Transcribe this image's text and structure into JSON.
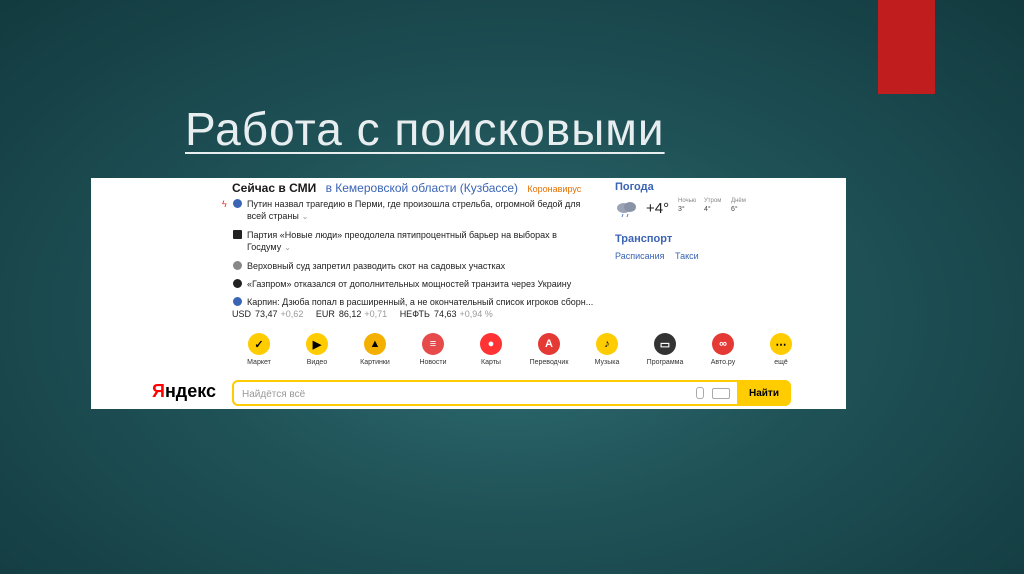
{
  "slide": {
    "title": "Работа с поисковыми"
  },
  "news": {
    "heading": "Сейчас в СМИ",
    "region": "в Кемеровской области (Кузбассе)",
    "tag": "Коронавирус",
    "items": [
      {
        "text": "Путин назвал трагедию в Перми, где произошла стрельба, огромной бедой для всей страны",
        "chevron": "⌄"
      },
      {
        "text": "Партия «Новые люди» преодолела пятипроцентный барьер на выборах в Госдуму",
        "chevron": "⌄"
      },
      {
        "text": "Верховный суд запретил разводить скот на садовых участках"
      },
      {
        "text": "«Газпром» отказался от дополнительных мощностей транзита через Украину"
      },
      {
        "text": "Карпин: Дзюба попал в расширенный, а не окончательный список игроков сборн..."
      }
    ]
  },
  "rates": [
    {
      "name": "USD",
      "value": "73,47",
      "delta": "+0,62"
    },
    {
      "name": "EUR",
      "value": "86,12",
      "delta": "+0,71"
    },
    {
      "name": "НЕФТЬ",
      "value": "74,63",
      "delta": "+0,94 %"
    }
  ],
  "weather": {
    "title": "Погода",
    "temp": "+4°",
    "forecast": [
      {
        "label": "Ночью",
        "value": "3°"
      },
      {
        "label": "Утром",
        "value": "4°"
      },
      {
        "label": "Днём",
        "value": "6°"
      }
    ]
  },
  "transport": {
    "title": "Транспорт",
    "links": [
      "Расписания",
      "Такси"
    ]
  },
  "services": [
    {
      "label": "Маркет",
      "icon": "market-icon",
      "color": "#fc0",
      "glyph": "✓"
    },
    {
      "label": "Видео",
      "icon": "video-icon",
      "color": "#fc0",
      "glyph": "▶"
    },
    {
      "label": "Картинки",
      "icon": "images-icon",
      "color": "#f4b000",
      "glyph": "▲"
    },
    {
      "label": "Новости",
      "icon": "news-icon",
      "color": "#e64a4a",
      "glyph": "≡"
    },
    {
      "label": "Карты",
      "icon": "maps-icon",
      "color": "#f33",
      "glyph": "●"
    },
    {
      "label": "Переводчик",
      "icon": "translator-icon",
      "color": "#e53935",
      "glyph": "A"
    },
    {
      "label": "Музыка",
      "icon": "music-icon",
      "color": "#fc0",
      "glyph": "♪"
    },
    {
      "label": "Программа",
      "icon": "tv-program-icon",
      "color": "#333",
      "glyph": "▭"
    },
    {
      "label": "Авто.ру",
      "icon": "autoru-icon",
      "color": "#e53935",
      "glyph": "∞"
    },
    {
      "label": "ещё",
      "icon": "more-icon",
      "color": "#fc0",
      "glyph": "⋯"
    }
  ],
  "search": {
    "logo_first": "Я",
    "logo_rest": "ндекс",
    "placeholder": "Найдётся всё",
    "button": "Найти"
  }
}
